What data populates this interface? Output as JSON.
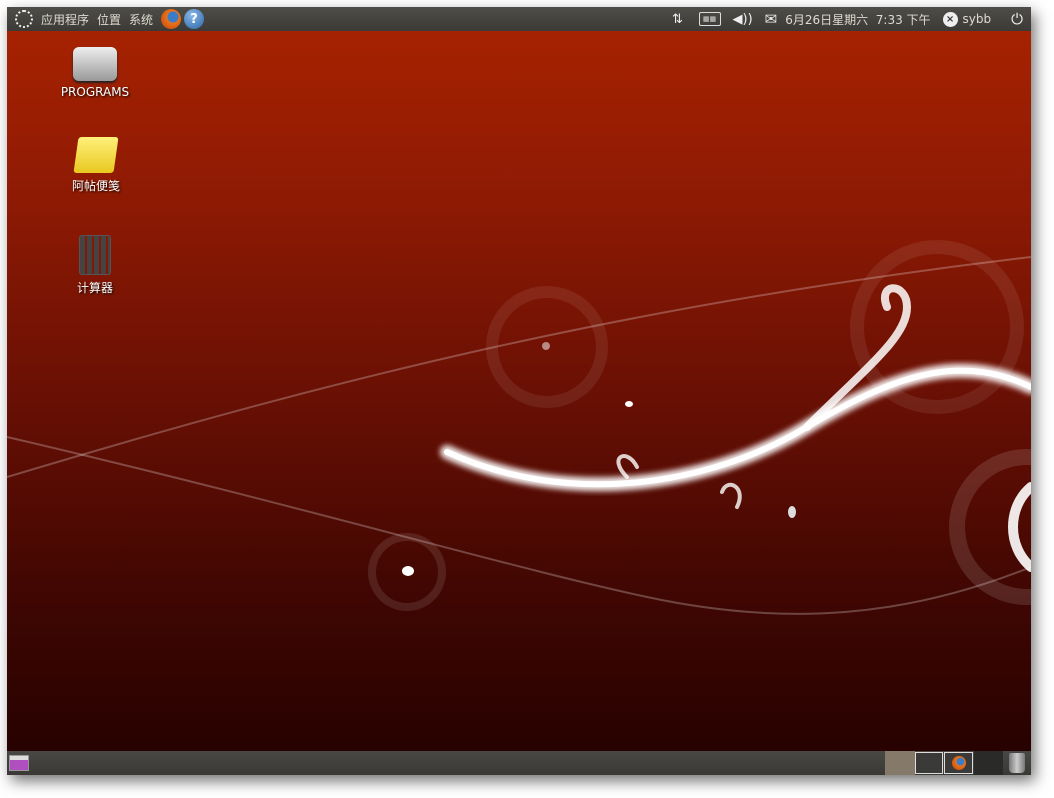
{
  "top_panel": {
    "menus": [
      {
        "label": "应用程序"
      },
      {
        "label": "位置"
      },
      {
        "label": "系统"
      }
    ],
    "launchers": [
      "firefox-icon",
      "help-icon"
    ],
    "clock": "6月26日星期六  7:33 下午",
    "user": "sybb"
  },
  "desktop": {
    "icons": [
      {
        "label": "PROGRAMS"
      },
      {
        "label": "阿帖便笺"
      },
      {
        "label": "计算器"
      }
    ]
  },
  "colors": {
    "panel": "#3f3e3a",
    "desktop_top": "#a92300",
    "desktop_bottom": "#230100"
  }
}
